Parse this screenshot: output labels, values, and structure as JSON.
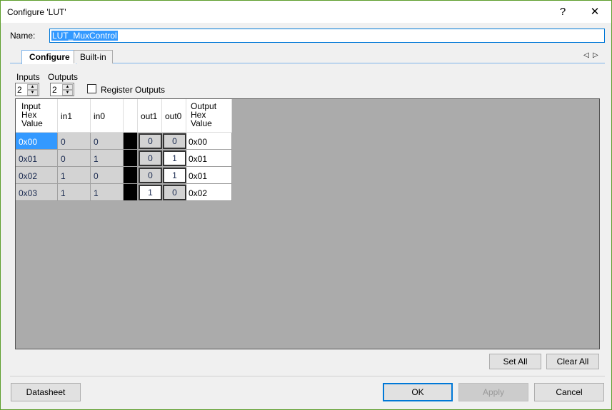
{
  "window": {
    "title": "Configure 'LUT'",
    "help": "?",
    "close": "✕"
  },
  "name": {
    "label": "Name:",
    "value": "LUT_MuxControl"
  },
  "tabs": [
    {
      "label": "Configure",
      "active": true
    },
    {
      "label": "Built-in",
      "active": false
    }
  ],
  "tab_scroll": {
    "left": "◁",
    "right": "▷"
  },
  "inputs": {
    "label": "Inputs",
    "value": "2"
  },
  "outputs": {
    "label": "Outputs",
    "value": "2"
  },
  "register_outputs": {
    "label": "Register Outputs",
    "checked": false
  },
  "table": {
    "headers": {
      "input_hex": [
        "Input",
        "Hex",
        "Value"
      ],
      "in1": "in1",
      "in0": "in0",
      "out1": "out1",
      "out0": "out0",
      "output_hex": [
        "Output",
        "Hex",
        "Value"
      ]
    },
    "rows": [
      {
        "input_hex": "0x00",
        "in1": "0",
        "in0": "0",
        "out1": "0",
        "out0": "0",
        "output_hex": "0x00"
      },
      {
        "input_hex": "0x01",
        "in1": "0",
        "in0": "1",
        "out1": "0",
        "out0": "1",
        "output_hex": "0x01"
      },
      {
        "input_hex": "0x02",
        "in1": "1",
        "in0": "0",
        "out1": "0",
        "out0": "1",
        "output_hex": "0x01"
      },
      {
        "input_hex": "0x03",
        "in1": "1",
        "in0": "1",
        "out1": "1",
        "out0": "0",
        "output_hex": "0x02"
      }
    ],
    "selected_row": 0
  },
  "buttons": {
    "set_all": "Set All",
    "clear_all": "Clear All",
    "datasheet": "Datasheet",
    "ok": "OK",
    "apply": "Apply",
    "cancel": "Cancel"
  },
  "colors": {
    "selection": "#3399ff",
    "window_border": "#5c9d2c",
    "set_bit": "#ffffff",
    "clear_bit": "#d3d3d3"
  }
}
